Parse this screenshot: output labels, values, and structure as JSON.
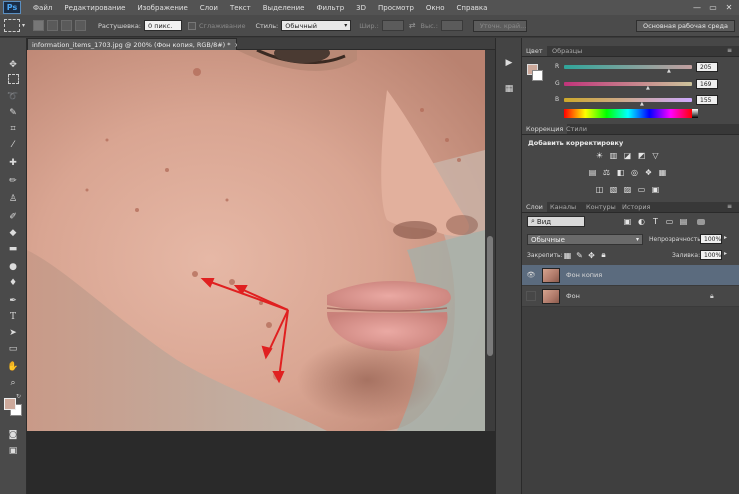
{
  "app": {
    "logo": "Ps"
  },
  "menu": [
    "Файл",
    "Редактирование",
    "Изображение",
    "Слои",
    "Текст",
    "Выделение",
    "Фильтр",
    "3D",
    "Просмотр",
    "Окно",
    "Справка"
  ],
  "window_controls": [
    "—",
    "▭",
    "✕"
  ],
  "options": {
    "feather_label": "Растушевка:",
    "feather_value": "0 пикс.",
    "antialias_label": "Сглаживание",
    "style_label": "Стиль:",
    "style_value": "Обычный",
    "width_label": "Шир.:",
    "height_label": "Выс.:",
    "refine_edge": "Уточн. край...",
    "workspace": "Основная рабочая среда"
  },
  "document": {
    "tab_title": "information_items_1703.jpg @ 200% (Фон копия, RGB/8#) *",
    "tab_close": "×"
  },
  "color_panel": {
    "tabs": [
      "Цвет",
      "Образцы"
    ],
    "channels": [
      {
        "label": "R",
        "value": "205"
      },
      {
        "label": "G",
        "value": "169"
      },
      {
        "label": "B",
        "value": "155"
      }
    ],
    "fg_color": "#cda99b"
  },
  "adjustments_panel": {
    "tabs": [
      "Коррекция",
      "Стили"
    ],
    "title": "Добавить корректировку"
  },
  "layers_panel": {
    "tabs": [
      "Слои",
      "Каналы",
      "Контуры",
      "История"
    ],
    "filter_kind": "Вид",
    "blend_mode": "Обычные",
    "opacity_label": "Непрозрачность:",
    "opacity_value": "100%",
    "lock_label": "Закрепить:",
    "fill_label": "Заливка:",
    "fill_value": "100%",
    "layers": [
      {
        "name": "Фон копия",
        "selected": true,
        "visible": true
      },
      {
        "name": "Фон",
        "selected": false,
        "visible": false,
        "locked": true
      }
    ]
  },
  "colors": {
    "accent_selected": "#5b6b7e",
    "arrow": "#e02020"
  }
}
